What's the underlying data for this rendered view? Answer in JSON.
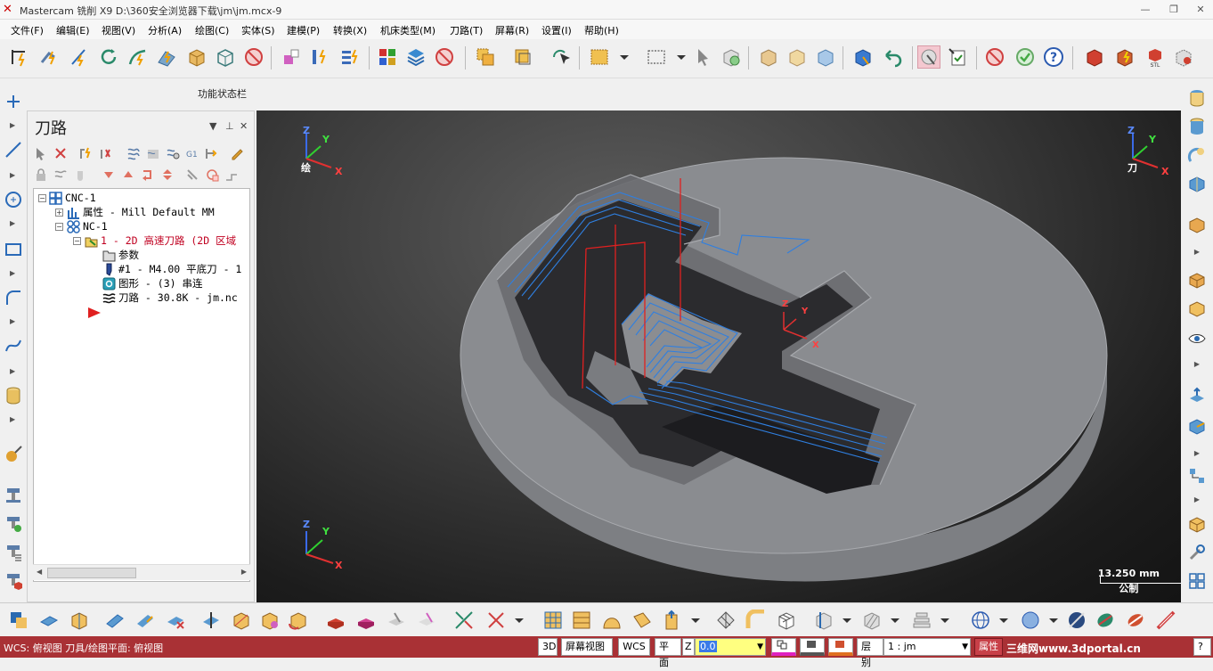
{
  "window": {
    "title": "Mastercam 铣削 X9  D:\\360安全浏览器下载\\jm\\jm.mcx-9",
    "controls": [
      "—",
      "❐",
      "✕"
    ]
  },
  "menu": [
    "文件(F)",
    "编辑(E)",
    "视图(V)",
    "分析(A)",
    "绘图(C)",
    "实体(S)",
    "建模(P)",
    "转换(X)",
    "机床类型(M)",
    "刀路(T)",
    "屏幕(R)",
    "设置(I)",
    "帮助(H)"
  ],
  "function_status": "功能状态栏",
  "panel": {
    "title": "刀路",
    "controls": [
      "▼",
      "⊥",
      "✕"
    ],
    "tree": [
      {
        "label": "CNC-1"
      },
      {
        "label": "属性 - Mill Default MM"
      },
      {
        "label": "NC-1"
      },
      {
        "label": "1 - 2D 高速刀路 (2D 区域"
      },
      {
        "label": "参数"
      },
      {
        "label": "#1 - M4.00 平底刀 - 1"
      },
      {
        "label": "图形 - (3) 串连"
      },
      {
        "label": "刀路 - 30.8K - jm.nc"
      }
    ]
  },
  "viewport": {
    "gview_axes": {
      "z": "Z",
      "y": "Y",
      "x": "X",
      "label": "绘"
    },
    "tview_axes": {
      "z": "Z",
      "y": "Y",
      "x": "X",
      "label": "刀"
    },
    "wcs_axes": {
      "z": "Z",
      "y": "Y",
      "x": "X"
    },
    "origin_axes": {
      "z": "Z",
      "y": "Y",
      "x": "X"
    },
    "scale": {
      "value": "13.250 mm",
      "unit": "公制"
    }
  },
  "status": {
    "left": "WCS: 俯视图  刀具/绘图平面: 俯视图",
    "mode": "3D",
    "gview": "屏幕视图",
    "wcs": "WCS",
    "plane": "平面",
    "z_label": "Z",
    "z_value": "0.0",
    "layer_label": "层别",
    "layer_value": "1 : jm",
    "attr": "属性",
    "watermark": "三维网www.3dportal.cn",
    "help": "?"
  },
  "colors": {
    "status_bar": "#a93135",
    "toolpath": "#2f7fe0",
    "plunge": "#e02020",
    "part": "#8a8c90"
  }
}
